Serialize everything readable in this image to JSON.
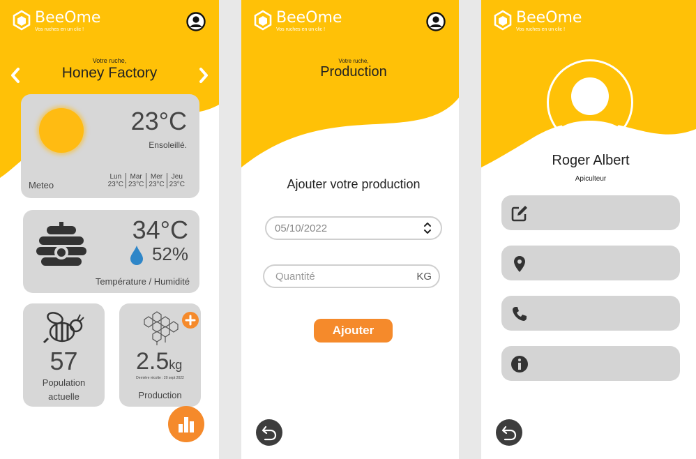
{
  "brand": {
    "name": "BeeOme",
    "tagline": "Vos ruches en un clic !"
  },
  "colors": {
    "yellow": "#ffc107",
    "orange": "#f58a2b",
    "card": "#d7d7d7",
    "dark": "#3d3d3d"
  },
  "dashboard": {
    "hive_label": "Votre ruche,",
    "hive_name": "Honey Factory",
    "weather": {
      "temperature": "23°C",
      "condition": "Ensoleillé.",
      "label": "Meteo",
      "forecast": [
        {
          "day": "Lun",
          "temp": "23°C"
        },
        {
          "day": "Mar",
          "temp": "23°C"
        },
        {
          "day": "Mer",
          "temp": "23°C"
        },
        {
          "day": "Jeu",
          "temp": "23°C"
        }
      ]
    },
    "hive": {
      "temperature": "34°C",
      "humidity": "52%",
      "label": "Température / Humidité"
    },
    "population": {
      "value": "57",
      "label_line1": "Population",
      "label_line2": "actuelle"
    },
    "production": {
      "value": "2.5",
      "unit": "kg",
      "last_harvest": "Dernière récolte : 20 sept 2022",
      "label": "Production"
    }
  },
  "production_screen": {
    "hive_label": "Votre ruche,",
    "title": "Production",
    "heading": "Ajouter votre production",
    "date_value": "05/10/2022",
    "quantity_placeholder": "Quantité",
    "quantity_unit": "KG",
    "submit_label": "Ajouter"
  },
  "profile_screen": {
    "name": "Roger Albert",
    "role": "Apiculteur",
    "icons": [
      "edit-icon",
      "location-pin-icon",
      "phone-icon",
      "info-icon"
    ]
  }
}
